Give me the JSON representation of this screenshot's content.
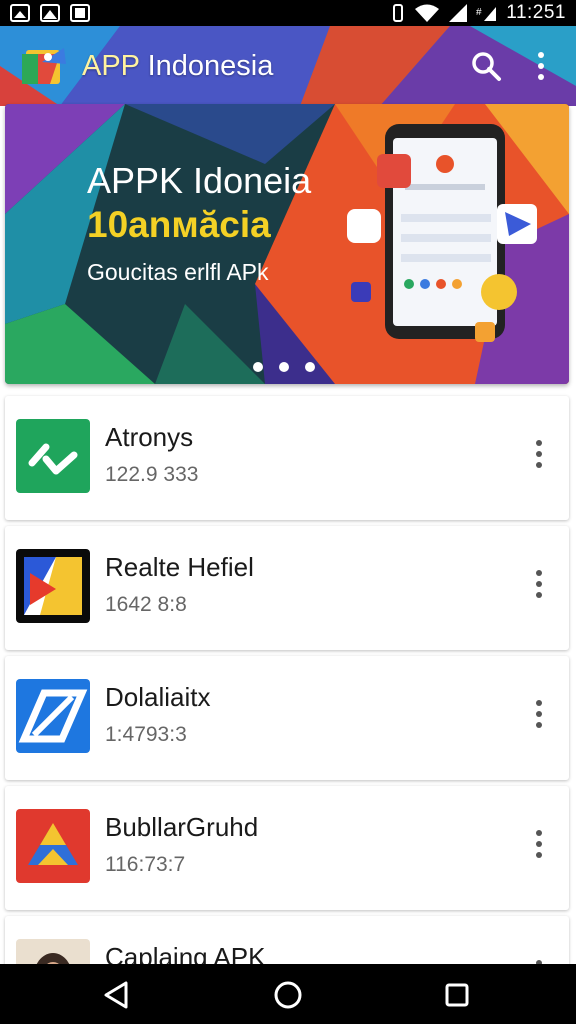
{
  "status_bar": {
    "time": "11:251",
    "icons": [
      "image-icon",
      "mountain-icon",
      "sd-card-icon",
      "vibrate-icon",
      "wifi-icon",
      "signal-icon",
      "data-icon"
    ]
  },
  "app_bar": {
    "title_first": "APP",
    "title_rest": " Indonesia",
    "actions": [
      "search-icon",
      "more-vert-icon"
    ]
  },
  "banner": {
    "title": "APPK Idoneia",
    "subtitle": "10anмăcia",
    "tagline": "Goucitas erlfl APk",
    "page_indicator": {
      "count": 3,
      "active": 0
    }
  },
  "apps": [
    {
      "name": "Atronys",
      "meta": "122.9 333",
      "icon": "green-check-icon"
    },
    {
      "name": "Realte Hefiel",
      "meta": "1642 8:8",
      "icon": "colorful-folder-icon"
    },
    {
      "name": "Dolaliaitx",
      "meta": "1:4793:3",
      "icon": "blue-parallelogram-icon"
    },
    {
      "name": "BubllarGruhd",
      "meta": "116:73:7",
      "icon": "drive-triangle-icon"
    },
    {
      "name": "Caplaing APK",
      "meta": "",
      "icon": "person-photo-icon"
    }
  ],
  "nav_bar": {
    "buttons": [
      "back-icon",
      "home-icon",
      "recents-icon"
    ]
  },
  "colors": {
    "status_bar": "#000000",
    "title_accent": "#fff2a0",
    "banner_subtitle": "#f4d125",
    "list_bg": "#ffffff"
  }
}
